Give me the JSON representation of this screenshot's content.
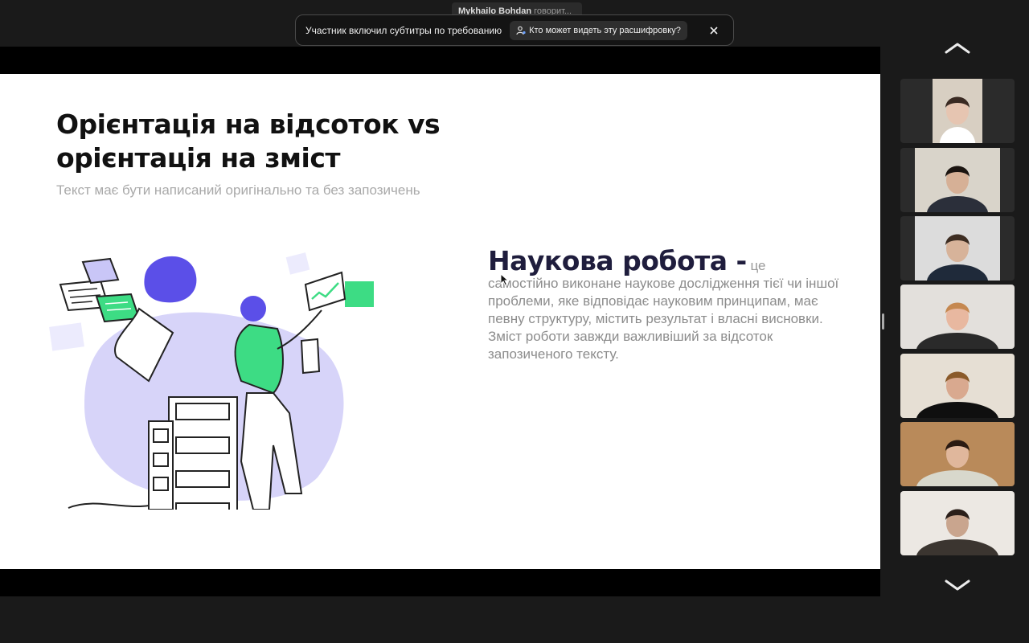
{
  "speaker_tag": {
    "name": "Mykhailo Bohdan",
    "status": "говорит..."
  },
  "caption_banner": {
    "text": "Участник включил субтитры по требованию",
    "who_button": "Кто может видеть эту расшифровку?"
  },
  "slide": {
    "title": "Орієнтація на відсоток vs орієнтація на зміст",
    "subtitle": "Текст має бути написаний оригінально та без запозичень",
    "definition_heading": "Наукова робота -",
    "definition_lead": "це",
    "definition_body": "самостійно виконане наукове дослідження тієї чи іншої проблеми, яке відповідає науковим принципам,  має певну структуру, містить результат і власні висновки.",
    "definition_note": "Зміст роботи завжди важливіший за відсоток запозиченого тексту."
  },
  "colors": {
    "accent_green": "#3ddc84",
    "illustration_blue": "#5b4fe8",
    "lavender": "#c9c6f7",
    "title_dark": "#1f1d3d"
  },
  "gallery": {
    "participants": [
      {
        "id": "p1",
        "tone": "#d8cfc2",
        "skin": "#e6c5b1",
        "hair": "#3a2a22",
        "shirt": "#ffffff"
      },
      {
        "id": "p2",
        "tone": "#d9d4ca",
        "skin": "#d6b096",
        "hair": "#1b1410",
        "shirt": "#2b2f3a"
      },
      {
        "id": "p3",
        "tone": "#dcdcdc",
        "skin": "#d7b39a",
        "hair": "#3d2d22",
        "shirt": "#1f2a3a"
      },
      {
        "id": "p4",
        "tone": "#e3e0dc",
        "skin": "#e8b8a0",
        "hair": "#c58850",
        "shirt": "#2a2a2a"
      },
      {
        "id": "p5",
        "tone": "#e6dfd4",
        "skin": "#d9a98f",
        "hair": "#8a5a2a",
        "shirt": "#0f0f0f"
      },
      {
        "id": "p6",
        "tone": "#b98a5a",
        "skin": "#e0b79c",
        "hair": "#2a1a12",
        "shirt": "#d8d8cc"
      },
      {
        "id": "p7",
        "tone": "#ece8e3",
        "skin": "#c9a58e",
        "hair": "#2a1f1a",
        "shirt": "#3b3530"
      }
    ]
  }
}
